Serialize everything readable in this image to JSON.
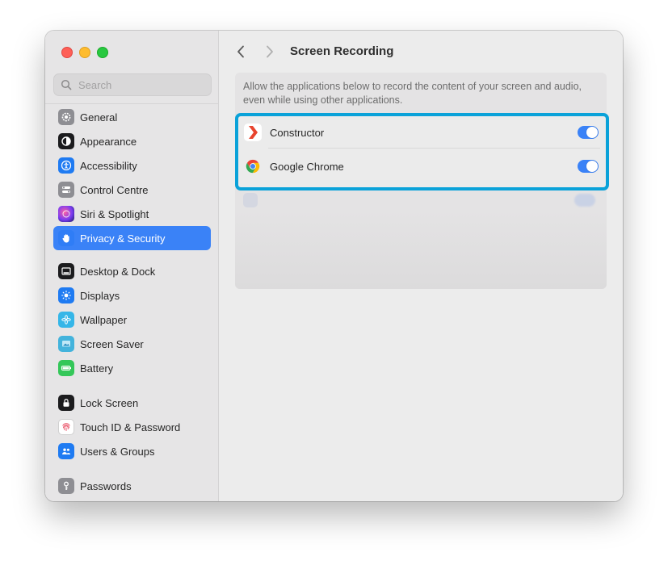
{
  "window": {
    "title": "Screen Recording"
  },
  "search": {
    "placeholder": "Search"
  },
  "sidebar": {
    "groups": [
      [
        {
          "label": "General",
          "icon": "gear-icon"
        },
        {
          "label": "Appearance",
          "icon": "appearance-icon"
        },
        {
          "label": "Accessibility",
          "icon": "accessibility-icon"
        },
        {
          "label": "Control Centre",
          "icon": "control-centre-icon"
        },
        {
          "label": "Siri & Spotlight",
          "icon": "siri-icon"
        },
        {
          "label": "Privacy & Security",
          "icon": "hand-icon",
          "selected": true
        }
      ],
      [
        {
          "label": "Desktop & Dock",
          "icon": "dock-icon"
        },
        {
          "label": "Displays",
          "icon": "sun-icon"
        },
        {
          "label": "Wallpaper",
          "icon": "flower-icon"
        },
        {
          "label": "Screen Saver",
          "icon": "screen-saver-icon"
        },
        {
          "label": "Battery",
          "icon": "battery-icon"
        }
      ],
      [
        {
          "label": "Lock Screen",
          "icon": "lock-icon"
        },
        {
          "label": "Touch ID & Password",
          "icon": "fingerprint-icon"
        },
        {
          "label": "Users & Groups",
          "icon": "users-icon"
        }
      ],
      [
        {
          "label": "Passwords",
          "icon": "key-icon"
        }
      ]
    ]
  },
  "main": {
    "description": "Allow the applications below to record the content of your screen and audio, even while using other applications.",
    "apps": [
      {
        "name": "Constructor",
        "icon": "constructor-app-icon",
        "enabled": true
      },
      {
        "name": "Google Chrome",
        "icon": "chrome-app-icon",
        "enabled": true
      }
    ]
  },
  "colors": {
    "accent": "#3a82f7",
    "highlight_border": "#0aa2d9"
  }
}
